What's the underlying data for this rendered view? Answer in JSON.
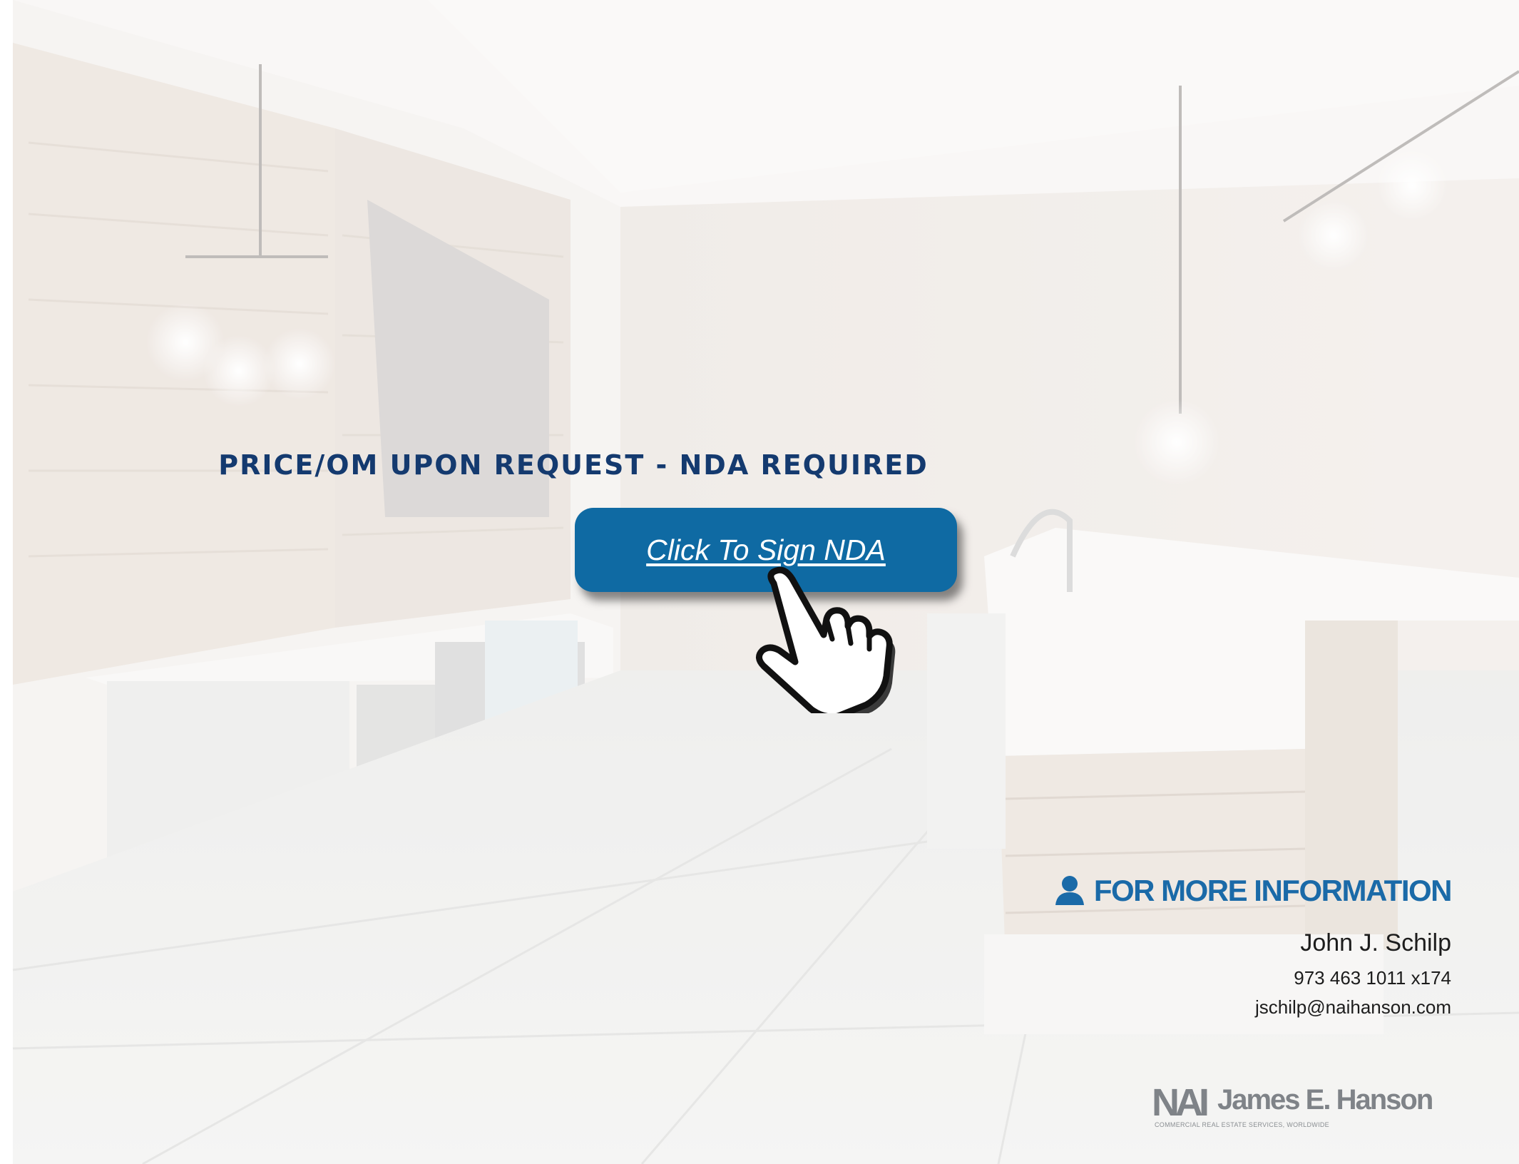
{
  "banner": {
    "heading": "PRICE/OM UPON REQUEST - NDA REQUIRED"
  },
  "cta": {
    "label": "Click To Sign NDA"
  },
  "contact": {
    "heading": "FOR MORE INFORMATION",
    "name": "John J. Schilp",
    "phone": "973 463 1011 x174",
    "email": "jschilp@naihanson.com"
  },
  "logo": {
    "mark": "NAI",
    "name": "James E. Hanson",
    "tagline": "COMMERCIAL REAL ESTATE SERVICES, WORLDWIDE"
  },
  "colors": {
    "heading": "#143a6f",
    "button": "#0f6aa3",
    "contact_heading": "#1a6aa8",
    "logo_gray": "#7f8388"
  },
  "icons": {
    "cursor": "pointing-hand-icon",
    "contact": "person-icon"
  }
}
